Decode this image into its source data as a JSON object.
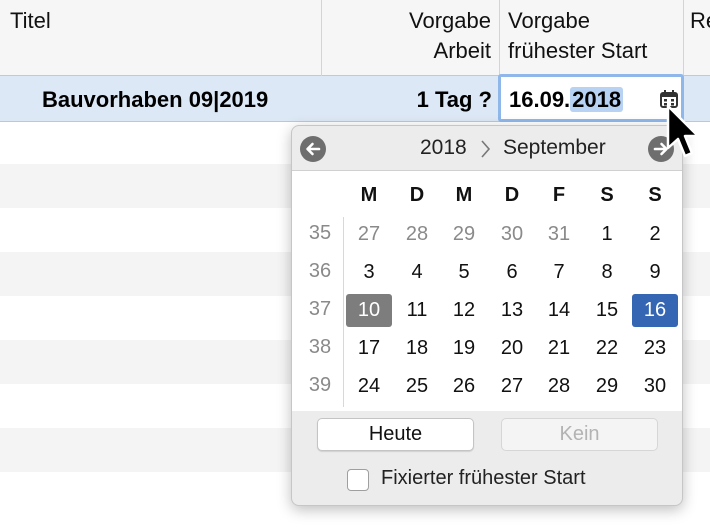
{
  "table": {
    "columns": {
      "title": "Titel",
      "work_line1": "Vorgabe",
      "work_line2": "Arbeit",
      "start_line1": "Vorgabe",
      "start_line2": "frühester Start",
      "next": "Re"
    },
    "selected_row": {
      "title": "Bauvorhaben 09|2019",
      "work": "1 Tag ?",
      "start_date_prefix": "16.09.",
      "start_date_selected": "2018"
    }
  },
  "calendar": {
    "year": "2018",
    "month": "September",
    "weekdays": [
      "M",
      "D",
      "M",
      "D",
      "F",
      "S",
      "S"
    ],
    "weeks": [
      {
        "number": "35",
        "days": [
          "27",
          "28",
          "29",
          "30",
          "31",
          "1",
          "2"
        ]
      },
      {
        "number": "36",
        "days": [
          "3",
          "4",
          "5",
          "6",
          "7",
          "8",
          "9"
        ]
      },
      {
        "number": "37",
        "days": [
          "10",
          "11",
          "12",
          "13",
          "14",
          "15",
          "16"
        ]
      },
      {
        "number": "38",
        "days": [
          "17",
          "18",
          "19",
          "20",
          "21",
          "22",
          "23"
        ]
      },
      {
        "number": "39",
        "days": [
          "24",
          "25",
          "26",
          "27",
          "28",
          "29",
          "30"
        ]
      }
    ],
    "today_day": "10",
    "selected_day": "16",
    "today_button": "Heute",
    "none_button": "Kein",
    "fixed_start_label": "Fixierter frühester Start",
    "fixed_start_checked": false
  },
  "colors": {
    "selection_row": "#dde8f6",
    "selected_day": "#3466b3",
    "today_day": "#7d7d7d",
    "focus_ring": "#8fb7ea"
  },
  "icons": {
    "prev": "arrow-left-icon",
    "next": "arrow-right-icon",
    "calendar": "calendar-icon",
    "separator": "chevron-right-icon",
    "cursor": "mouse-pointer-icon"
  }
}
